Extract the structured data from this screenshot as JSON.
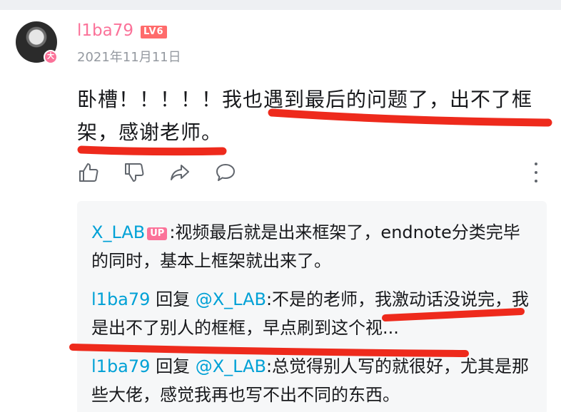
{
  "user": {
    "name": "l1ba79",
    "level": "LV6",
    "avatar_badge": "大",
    "date": "2021年11月11日"
  },
  "comment": {
    "text": "卧槽！！！！！我也遇到最后的问题了，出不了框架，感谢老师。"
  },
  "actions": {
    "icons": [
      "thumb-up-icon",
      "thumb-down-icon",
      "share-icon",
      "reply-icon",
      "more-icon"
    ]
  },
  "replies": [
    {
      "author": "X_LAB",
      "badge": "UP",
      "text": ":视频最后就是出来框架了，endnote分类完毕的同时，基本上框架就出来了。"
    },
    {
      "author": "l1ba79",
      "reply_word": "回复",
      "mention": "@X_LAB",
      "text": ":不是的老师，我激动话没说完，我是出不了别人的框框，早点刷到这个视..."
    },
    {
      "author": "l1ba79",
      "reply_word": "回复",
      "mention": "@X_LAB",
      "text": ":总觉得别人写的就很好，尤其是那些大佬，感觉我再也写不出不同的东西。"
    }
  ],
  "colors": {
    "accent": "#fb7299",
    "link": "#00a1d6",
    "annotation": "#ee2a1c",
    "level_badge": "#ff6b6b"
  }
}
